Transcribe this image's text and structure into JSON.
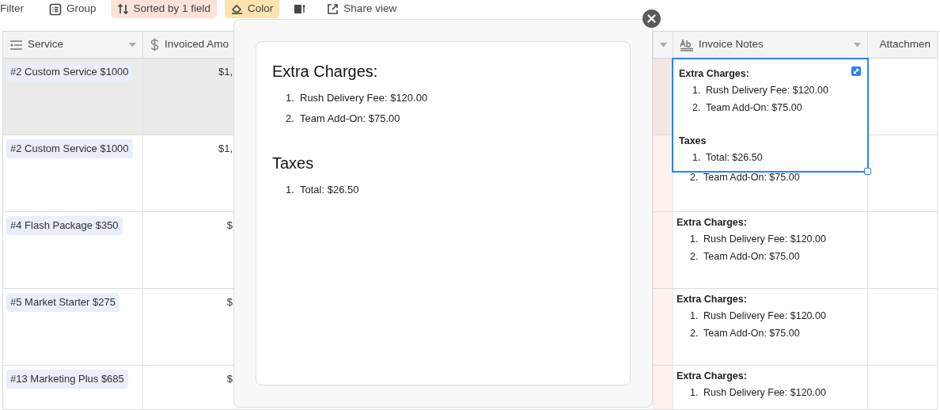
{
  "toolbar": [
    {
      "kind": "filter",
      "label": "Filter"
    },
    {
      "kind": "group",
      "label": "Group"
    },
    {
      "kind": "sort",
      "label": "Sorted by 1 field"
    },
    {
      "kind": "color",
      "label": "Color"
    },
    {
      "kind": "row-height"
    },
    {
      "kind": "share",
      "label": "Share view"
    }
  ],
  "table": {
    "columns": [
      {
        "kind": "select",
        "label": "Service"
      },
      {
        "kind": "currency",
        "label": "Invoiced Amo"
      },
      {
        "kind": "partial"
      },
      {
        "kind": "long-text",
        "label": "Invoice Notes"
      },
      {
        "kind": "attachment",
        "label": "Attachmen"
      }
    ],
    "rows": [
      {
        "selected": true,
        "service": "#2 Custom Service $1000",
        "amount": "$1,",
        "notes": [
          {
            "heading": "Extra Charges:",
            "items": [
              {
                "n": "1.",
                "text": "Rush Delivery Fee: $120.00"
              },
              {
                "n": "2.",
                "text": "Team Add-On: $75.00"
              }
            ]
          },
          {
            "heading": "Taxes",
            "items": [
              {
                "n": "1.",
                "text": "Total: $26.50"
              }
            ]
          }
        ]
      },
      {
        "selected": false,
        "service": "#2 Custom Service $1000",
        "amount": "$1,",
        "notes": [
          {
            "items": [
              {
                "n": "2.",
                "text": "Team Add-On: $75.00"
              }
            ]
          }
        ]
      },
      {
        "selected": false,
        "service": "#4 Flash Package $350",
        "amount": "$",
        "notes": [
          {
            "heading": "Extra Charges:",
            "items": [
              {
                "n": "1.",
                "text": "Rush Delivery Fee: $120.00"
              },
              {
                "n": "2.",
                "text": "Team Add-On: $75.00"
              }
            ]
          }
        ]
      },
      {
        "selected": false,
        "service": "#5 Market Starter $275",
        "amount": "$",
        "notes": [
          {
            "heading": "Extra Charges:",
            "items": [
              {
                "n": "1.",
                "text": "Rush Delivery Fee: $120.00"
              },
              {
                "n": "2.",
                "text": "Team Add-On: $75.00"
              }
            ]
          }
        ]
      },
      {
        "selected": false,
        "service": "#13 Marketing Plus $685",
        "amount": "$",
        "notes": [
          {
            "heading": "Extra Charges:",
            "items": [
              {
                "n": "1.",
                "text": "Rush Delivery Fee: $120.00"
              }
            ]
          }
        ]
      }
    ]
  },
  "expanded_note": {
    "sections": [
      {
        "heading": "Extra Charges:",
        "items": [
          {
            "n": "1.",
            "text": "Rush Delivery Fee: $120.00"
          },
          {
            "n": "2.",
            "text": "Team Add-On: $75.00"
          }
        ]
      },
      {
        "heading": "Taxes",
        "items": [
          {
            "n": "1.",
            "text": "Total: $26.50"
          }
        ]
      }
    ]
  }
}
